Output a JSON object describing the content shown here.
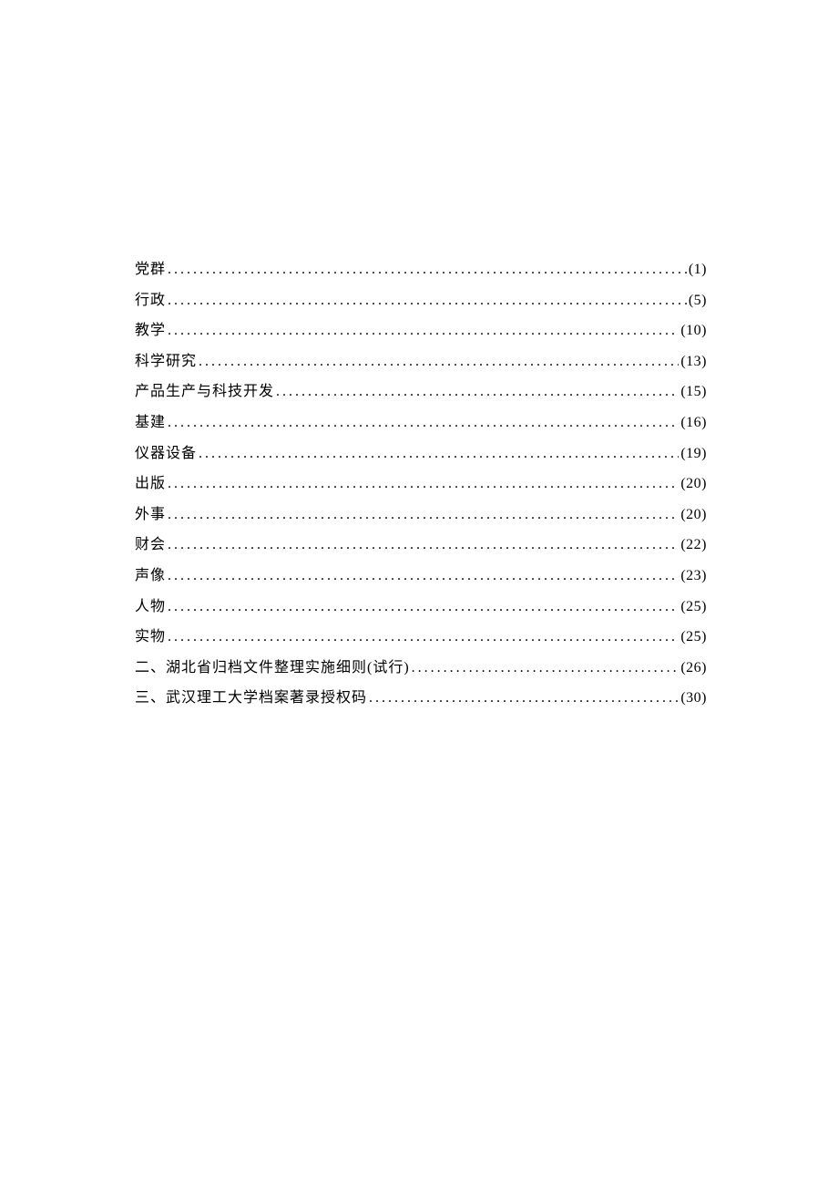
{
  "toc": {
    "entries": [
      {
        "label": "党群",
        "page": "(1)"
      },
      {
        "label": "行政",
        "page": "(5)"
      },
      {
        "label": "教学",
        "page": "(10)"
      },
      {
        "label": "科学研究",
        "page": "(13)"
      },
      {
        "label": "产品生产与科技开发",
        "page": "(15)"
      },
      {
        "label": "基建",
        "page": "(16)"
      },
      {
        "label": "仪器设备",
        "page": "(19)"
      },
      {
        "label": "出版",
        "page": "(20)"
      },
      {
        "label": "外事",
        "page": "(20)"
      },
      {
        "label": "财会",
        "page": "(22)"
      },
      {
        "label": "声像",
        "page": "(23)"
      },
      {
        "label": "人物",
        "page": "(25)"
      },
      {
        "label": "实物",
        "page": "(25)"
      },
      {
        "label": "二、湖北省归档文件整理实施细则(试行)",
        "page": "(26)"
      },
      {
        "label": "三、武汉理工大学档案著录授权码",
        "page": "(30)"
      }
    ]
  }
}
